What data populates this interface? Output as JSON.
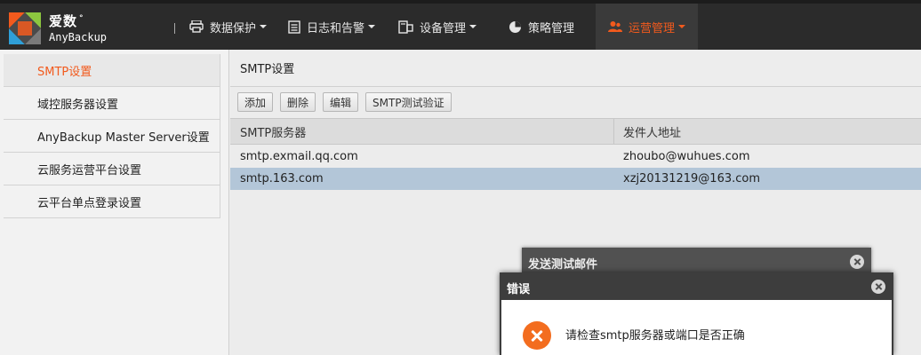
{
  "header": {
    "brand_cn": "爱数",
    "brand_en": "AnyBackup",
    "nav": [
      {
        "label": "数据保护",
        "icon": "printer-icon",
        "has_menu": true
      },
      {
        "label": "日志和告警",
        "icon": "document-icon",
        "has_menu": true
      },
      {
        "label": "设备管理",
        "icon": "devices-icon",
        "has_menu": true
      },
      {
        "label": "策略管理",
        "icon": "pie-chart-icon",
        "has_menu": false
      },
      {
        "label": "运营管理",
        "icon": "users-icon",
        "has_menu": true,
        "active": true
      }
    ],
    "accent_color": "#f25a1d"
  },
  "sidebar": {
    "items": [
      {
        "label": "SMTP设置",
        "selected": true
      },
      {
        "label": "域控服务器设置"
      },
      {
        "label": "AnyBackup Master Server设置"
      },
      {
        "label": "云服务运营平台设置"
      },
      {
        "label": "云平台单点登录设置"
      }
    ]
  },
  "main": {
    "title": "SMTP设置",
    "toolbar": {
      "add": "添加",
      "delete": "删除",
      "edit": "编辑",
      "test": "SMTP测试验证"
    },
    "table": {
      "columns": [
        "SMTP服务器",
        "发件人地址"
      ],
      "rows": [
        {
          "server": "smtp.exmail.qq.com",
          "sender": "zhoubo@wuhues.com",
          "selected": false
        },
        {
          "server": "smtp.163.com",
          "sender": "xzj20131219@163.com",
          "selected": true
        }
      ]
    }
  },
  "dialog_back": {
    "title": "发送测试邮件"
  },
  "dialog_error": {
    "title": "错误",
    "message": "请检查smtp服务器或端口是否正确",
    "icon": "error-icon"
  }
}
